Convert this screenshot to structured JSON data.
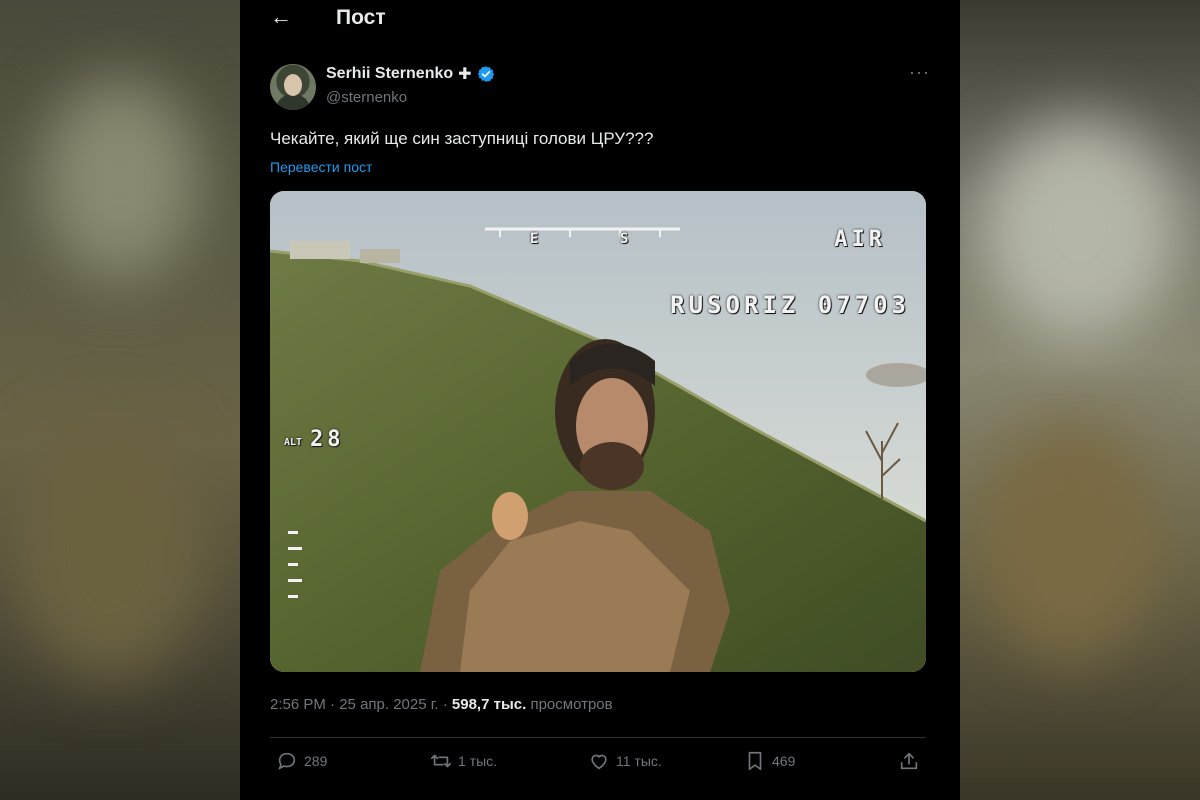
{
  "header": {
    "back_icon": "arrow-left-icon",
    "title": "Пост"
  },
  "author": {
    "name": "Serhii Sternenko",
    "badge_plus": "✚",
    "verified_icon": "verified-badge-icon",
    "handle": "@sternenko",
    "more_icon": "more-dots-icon",
    "more_label": "···"
  },
  "post": {
    "text": "Чекайте, який ще син заступниці голови ЦРУ???",
    "translate_label": "Перевести пост",
    "media": {
      "osd_air": "AIR",
      "osd_id": "RUSORIZ 07703",
      "osd_alt_label": "ALT",
      "osd_alt": "28",
      "compass_e": "E",
      "compass_s": "S"
    }
  },
  "meta": {
    "time": "2:56 PM",
    "sep1": "·",
    "date": "25 апр. 2025 г.",
    "sep2": "·",
    "views_count": "598,7 тыс.",
    "views_label": "просмотров"
  },
  "actions": {
    "replies": "289",
    "reposts": "1 тыс.",
    "likes": "11 тыс.",
    "bookmarks": "469"
  },
  "colors": {
    "accent": "#1d9bf0",
    "background": "#000000",
    "muted": "#71767b",
    "text": "#e7e9ea"
  }
}
